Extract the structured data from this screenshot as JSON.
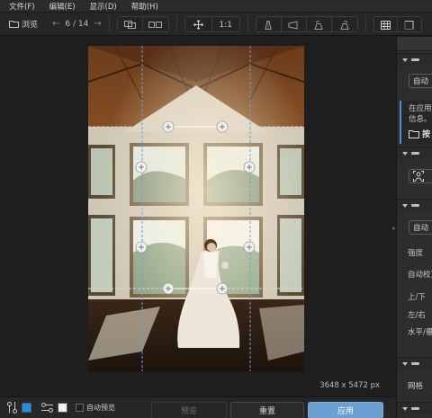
{
  "menu": [
    "文件(F)",
    "编辑(E)",
    "显示(D)",
    "帮助(H)"
  ],
  "toolbar": {
    "browse_label": "浏览",
    "page_indicator": "6 / 14",
    "zoom_label": "1:1"
  },
  "canvas": {
    "dimensions": "3648 x 5472 px"
  },
  "bottombar": {
    "auto_preview_label": "自动预览",
    "preview_label": "预览",
    "reset_label": "重置",
    "apply_label": "应用",
    "swatch_colors": [
      "#1e8fe6",
      "#f2f2f2"
    ]
  },
  "panel": {
    "auto_btn_1": "自动",
    "note_line_1": "在应用自",
    "note_line_2": "信息。",
    "folder_text": "按",
    "auto_btn_2": "自动",
    "strength": "强度",
    "auto_correct": "自动校正",
    "up_down": "上/下",
    "left_right": "左/右",
    "horizontal": "水平/垂",
    "grid": "网格"
  },
  "colors": {
    "accent": "#6a9fd2",
    "guide": "#6f9fda",
    "note_border": "#4d8fd6"
  }
}
